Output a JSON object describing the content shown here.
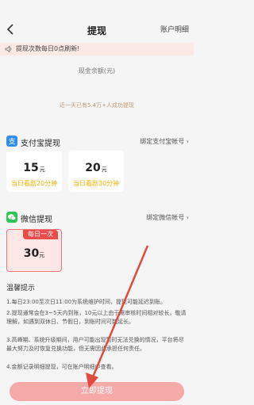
{
  "header": {
    "title": "提现",
    "link": "账户明细"
  },
  "notice": {
    "text": "提现次数每日0点刷新!"
  },
  "balance": {
    "label": "现金余额(元)",
    "value": ""
  },
  "stats": {
    "text": "近一天已有5.4万+人成功提现"
  },
  "alipay": {
    "title": "支付宝提现",
    "link": "绑定支付宝帐号",
    "options": [
      {
        "amount": "15",
        "unit": "元",
        "sub": "当日看剧20分钟"
      },
      {
        "amount": "20",
        "unit": "元",
        "sub": "当日看剧30分钟"
      }
    ]
  },
  "wechat": {
    "title": "微信提现",
    "link": "绑定微信帐号",
    "option": {
      "badge": "每日一次",
      "amount": "30",
      "unit": "元"
    }
  },
  "tips": {
    "title": "温馨提示",
    "items": [
      "1.每日23:00至次日11:00为系统维护时间，提现可能延迟到账。",
      "2.提现通常会在3~5天内到账，10元以上由于需审核时间相对较长，敬请理解，如遇到双休日、节假日，到账时间可能延长。",
      "3.高峰期、系统升级期间，用户可能出现暂时无法兑换的情况，平台将尽最大努力及时恢复兑换功能，但无需因此承担任何责任。",
      "4.金额记录明细提现，可在账户明细中查看。"
    ]
  },
  "submit": {
    "label": "立即提现"
  },
  "colors": {
    "accent": "#ea4b4b",
    "alipay": "#2f8cf2",
    "wechat": "#33c35a",
    "button": "#f5a9a9"
  }
}
